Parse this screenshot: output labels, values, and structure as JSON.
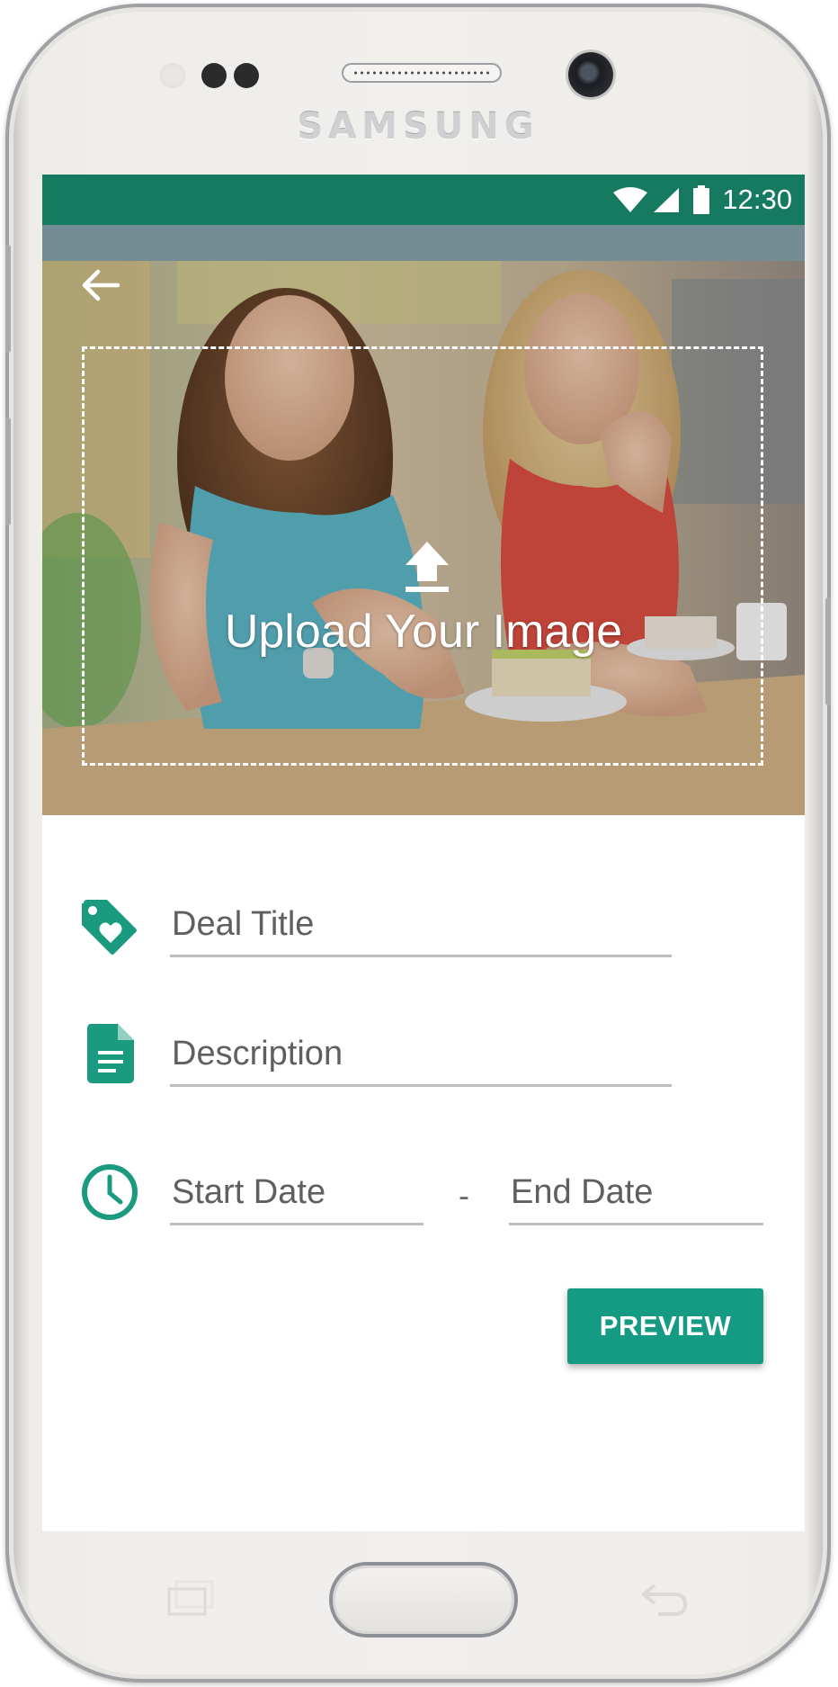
{
  "device": {
    "brand": "SAMSUNG"
  },
  "status_bar": {
    "time": "12:30",
    "icons": [
      "wifi-icon",
      "cellular-signal-icon",
      "battery-icon"
    ],
    "color": "#157a60"
  },
  "header": {
    "back_icon": "arrow-left-icon"
  },
  "upload": {
    "label": "Upload Your Image",
    "icon": "upload-icon"
  },
  "form": {
    "deal_title": {
      "placeholder": "Deal Title",
      "value": "",
      "icon": "tag-heart-icon"
    },
    "description": {
      "placeholder": "Description",
      "value": "",
      "icon": "document-icon"
    },
    "date_range": {
      "icon": "clock-icon",
      "start_placeholder": "Start Date",
      "separator": "-",
      "end_placeholder": "End Date"
    }
  },
  "actions": {
    "preview_label": "PREVIEW",
    "accent_color": "#159a83"
  },
  "nav_keys": [
    "recent-apps-icon",
    "home-button",
    "back-key-icon"
  ]
}
